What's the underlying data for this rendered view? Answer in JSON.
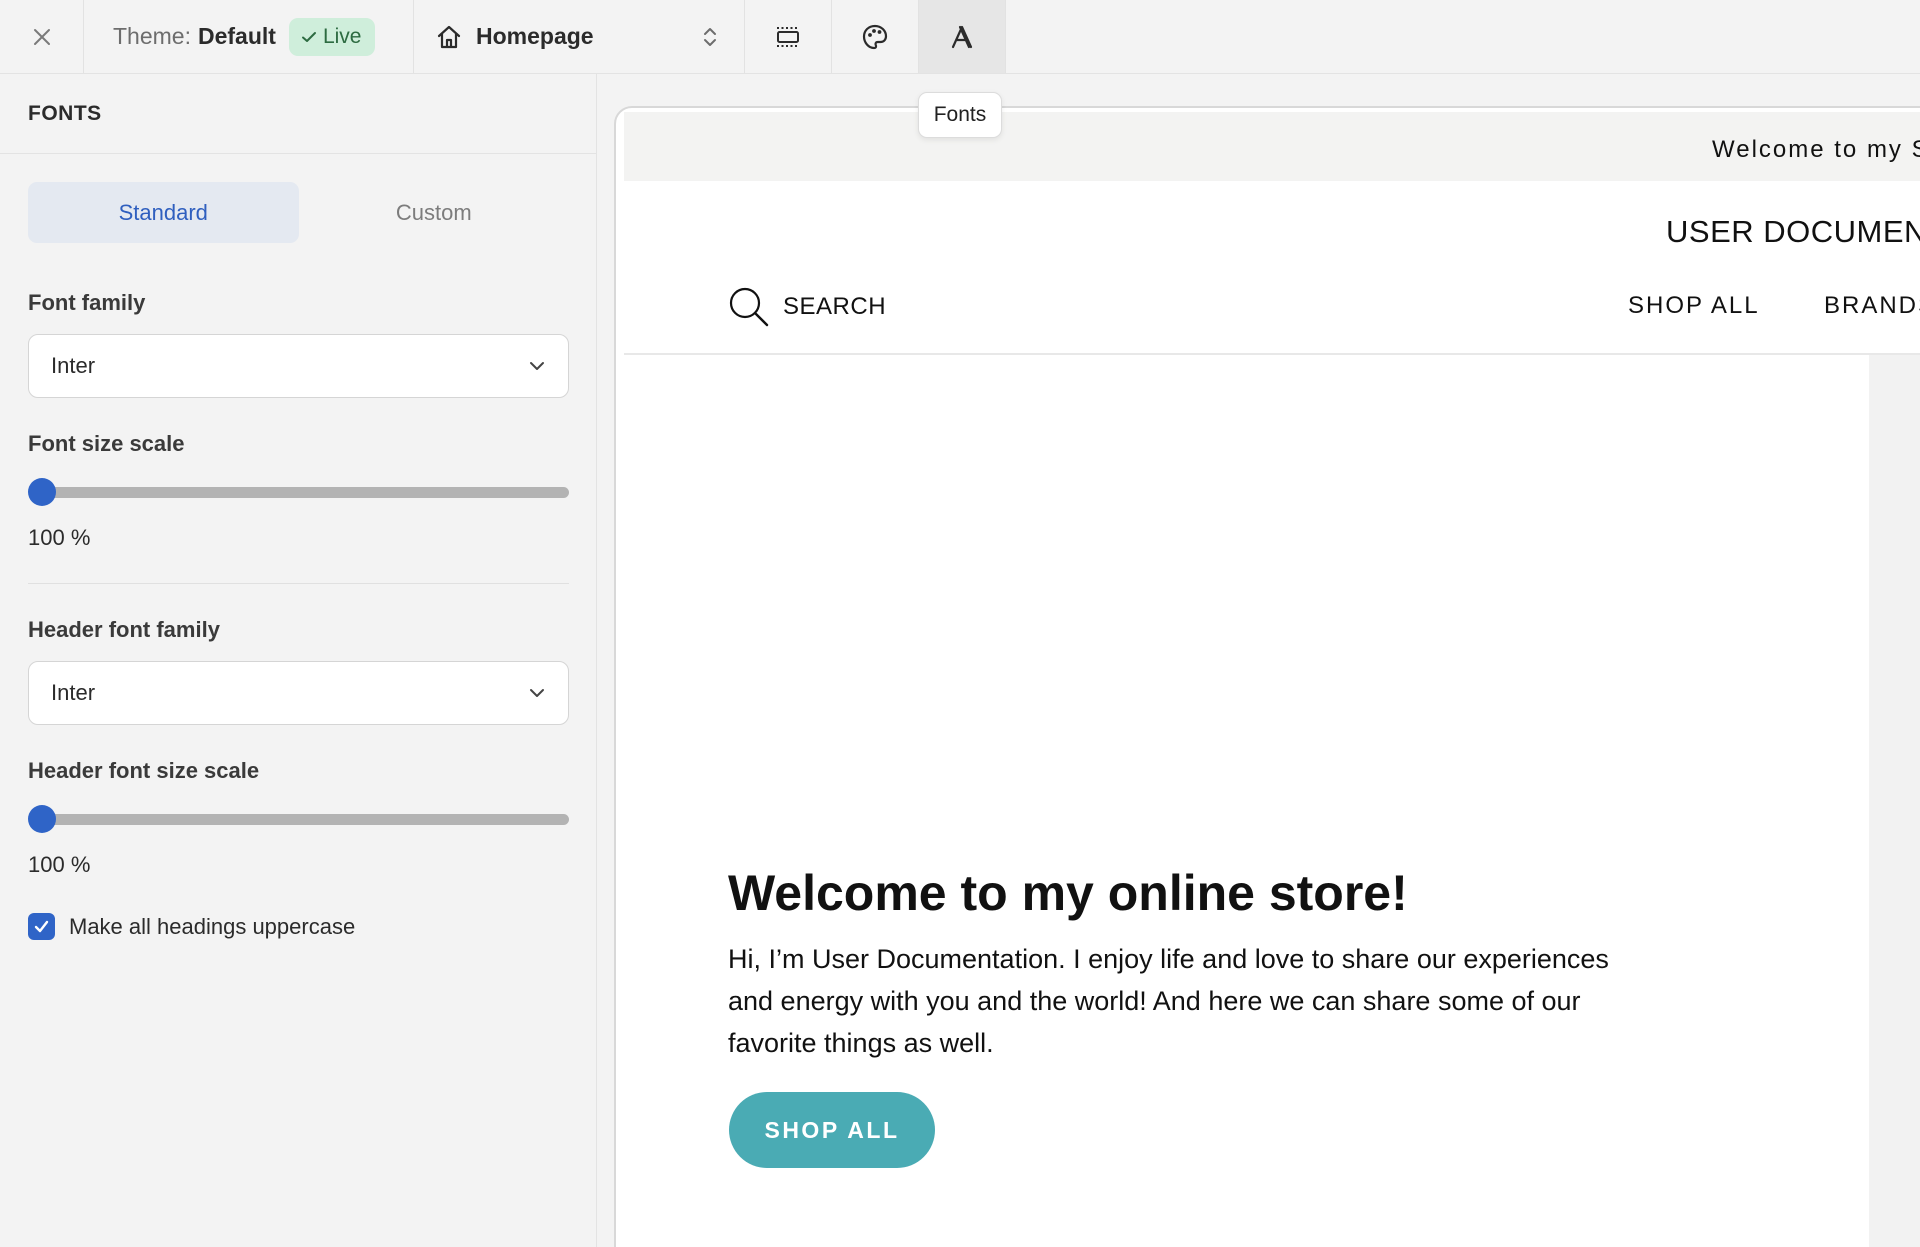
{
  "topbar": {
    "theme_label": "Theme:",
    "theme_name": "Default",
    "live_badge": "Live",
    "page_name": "Homepage"
  },
  "tooltip": {
    "fonts": "Fonts"
  },
  "panel": {
    "title": "FONTS",
    "tabs": [
      {
        "label": "Standard",
        "active": true
      },
      {
        "label": "Custom",
        "active": false
      }
    ],
    "font_family": {
      "label": "Font family",
      "value": "Inter"
    },
    "font_size_scale": {
      "label": "Font size scale",
      "value": "100 %",
      "level": 0
    },
    "header_font_family": {
      "label": "Header font family",
      "value": "Inter"
    },
    "header_font_size_scale": {
      "label": "Header font size scale",
      "value": "100 %",
      "level": 0
    },
    "uppercase": {
      "label": "Make all headings uppercase",
      "checked": true
    }
  },
  "preview": {
    "announcement": "Welcome to my S",
    "store_name": "USER DOCUMEN",
    "search_label": "SEARCH",
    "nav": [
      "SHOP ALL",
      "BRANDS"
    ],
    "hero_title": "Welcome to my online store!",
    "hero_body": "Hi, I’m User Documentation. I enjoy life and love to share our experiences and energy with you and the world! And here we can share some of our favorite things as well.",
    "hero_button": "SHOP ALL"
  },
  "colors": {
    "accent": "#2f64c7",
    "live_badge_bg": "#cfeedb",
    "hero_button": "#4aabb4"
  },
  "icons": [
    "close-icon",
    "check-icon",
    "home-icon",
    "updown-chevron-icon",
    "layout-icon",
    "palette-icon",
    "font-icon",
    "chevron-down-icon",
    "search-icon"
  ]
}
